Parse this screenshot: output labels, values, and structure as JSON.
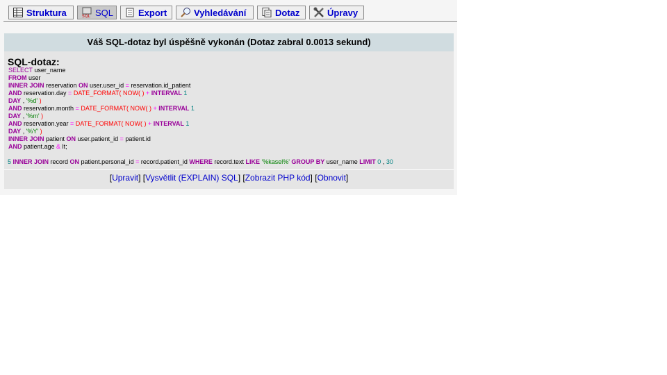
{
  "tabs": [
    {
      "label": "Struktura",
      "icon": "structure-icon"
    },
    {
      "label": "SQL",
      "icon": "sql-icon",
      "active": true
    },
    {
      "label": "Export",
      "icon": "export-icon"
    },
    {
      "label": "Vyhledávání",
      "icon": "search-icon"
    },
    {
      "label": "Dotaz",
      "icon": "query-icon"
    },
    {
      "label": "Úpravy",
      "icon": "tools-icon"
    }
  ],
  "result": {
    "message": "Váš SQL-dotaz byl úspěšně vykonán (Dotaz zabral 0.0013 sekund)",
    "query_heading": "SQL-dotaz:"
  },
  "sql": {
    "l1a": "SELECT",
    "l1b": " user_name",
    "l2a": "FROM",
    "l2b": " user",
    "l3a": "INNER JOIN",
    "l3b": " reservation ",
    "l3c": "ON",
    "l3d": " user.user_id ",
    "l3e": "=",
    "l3f": " reservation.id_patient",
    "l4a": "AND",
    "l4b": " reservation.day ",
    "l4c": "=",
    "l4d": " DATE_FORMAT(",
    "l4e": " NOW(",
    "l4f": " ) ",
    "l4g": "+",
    "l4h": " INTERVAL",
    "l4i": " 1",
    "l5a": "DAY",
    "l5b": " , ",
    "l5c": "'%d'",
    "l5d": " )",
    "l6a": "AND",
    "l6b": " reservation.month ",
    "l6c": "=",
    "l6d": " DATE_FORMAT(",
    "l6e": " NOW(",
    "l6f": " ) ",
    "l6g": "+",
    "l6h": " INTERVAL",
    "l6i": " 1",
    "l7a": "DAY",
    "l7b": " , ",
    "l7c": "'%m'",
    "l7d": " )",
    "l8a": "AND",
    "l8b": " reservation.year ",
    "l8c": "=",
    "l8d": " DATE_FORMAT(",
    "l8e": " NOW(",
    "l8f": " ) ",
    "l8g": "+",
    "l8h": " INTERVAL",
    "l8i": " 1",
    "l9a": "DAY",
    "l9b": " , ",
    "l9c": "'%Y'",
    "l9d": " )",
    "l10a": "INNER JOIN",
    "l10b": " patient ",
    "l10c": "ON",
    "l10d": " user.patient_id ",
    "l10e": "=",
    "l10f": " patient.id",
    "l11a": "AND",
    "l11b": " patient.age ",
    "l11c": "&",
    "l11d": " lt;",
    "l12a": "5",
    "l12b": " INNER JOIN",
    "l12c": " record ",
    "l12d": "ON",
    "l12e": " patient.personal_id ",
    "l12f": "=",
    "l12g": " record.patient_id ",
    "l12h": "WHERE",
    "l12i": " record.text ",
    "l12j": "LIKE",
    "l12k": " '%kasel%'",
    "l12l": " GROUP BY",
    "l12m": " user_name ",
    "l12n": "LIMIT",
    "l12o": " 0",
    "l12p": " , ",
    "l12q": "30"
  },
  "links": {
    "edit": "Upravit",
    "explain": "Vysvětlit (EXPLAIN) SQL",
    "php": "Zobrazit PHP kód",
    "refresh": "Obnovit"
  },
  "colors": {
    "keyword": "#990099",
    "function": "#ff0000",
    "string": "#008000",
    "number": "#008080",
    "link": "#0000cc",
    "header_bg": "#d0dce0"
  }
}
